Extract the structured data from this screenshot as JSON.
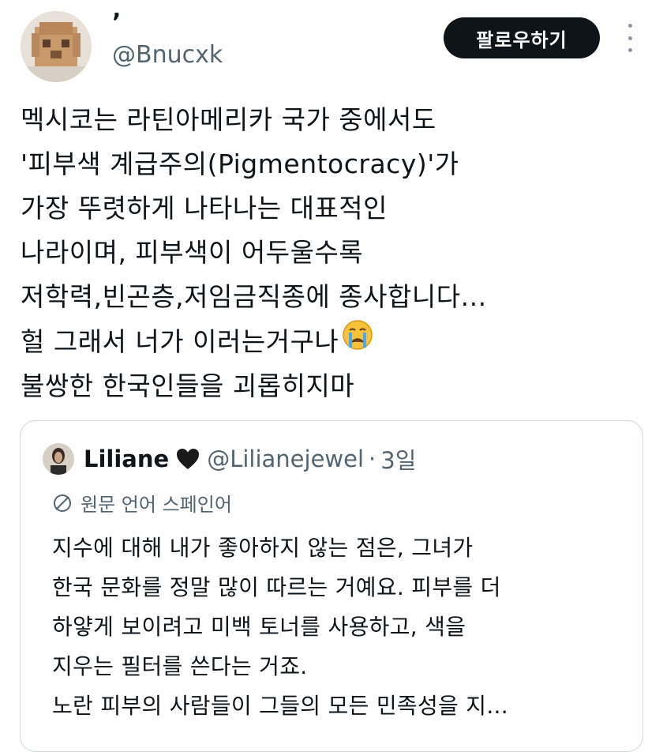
{
  "author": {
    "name": "’",
    "handle": "@Bnucxk"
  },
  "follow_label": "팔로우하기",
  "tweet": {
    "lines": [
      "멕시코는 라틴아메리카 국가 중에서도",
      "'피부색 계급주의(Pigmentocracy)'가",
      "가장 뚜렷하게 나타나는 대표적인",
      "나라이며, 피부색이 어두울수록",
      "저학력,빈곤층,저임금직종에 종사합니다...",
      "헐 그래서 너가 이러는거구나",
      "불쌍한 한국인들을 괴롭히지마"
    ],
    "emoji": "crying-face"
  },
  "quote": {
    "name": "Liliane",
    "handle": "@Lilianejewel",
    "separator": "·",
    "date": "3일",
    "translation_label": "원문 언어 스페인어",
    "lines": [
      "지수에 대해 내가 좋아하지 않는 점은, 그녀가",
      "한국 문화를 정말 많이 따르는 거예요. 피부를 더",
      "하얗게 보이려고 미백 토너를 사용하고, 색을",
      "지우는 필터를 쓴다는 거죠.",
      "노란 피부의 사람들이 그들의 모든 민족성을 지..."
    ]
  },
  "icons": {
    "more": "more-vertical-icon",
    "heart": "black-heart-icon",
    "translate": "translate-icon"
  },
  "colors": {
    "text": "#0f1419",
    "secondary": "#536471",
    "border": "#cfd9de",
    "button_bg": "#0f1419",
    "button_text": "#ffffff"
  }
}
